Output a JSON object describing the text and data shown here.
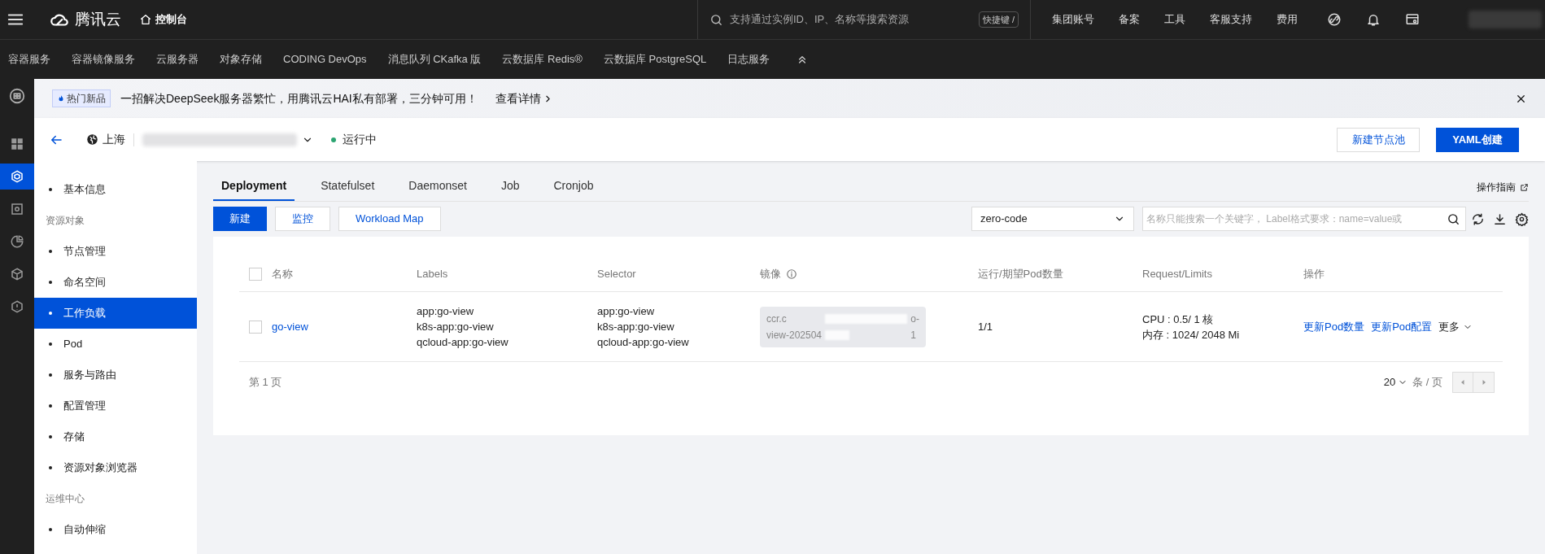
{
  "topbar": {
    "logo": "腾讯云",
    "console": "控制台",
    "search_placeholder": "支持通过实例ID、IP、名称等搜索资源",
    "shortcut": "快捷键 /",
    "links": [
      "集团账号",
      "备案",
      "工具",
      "客服支持",
      "费用"
    ]
  },
  "product_nav": {
    "items": [
      "容器服务",
      "容器镜像服务",
      "云服务器",
      "对象存储",
      "CODING DevOps",
      "消息队列 CKafka 版",
      "云数据库 Redis®",
      "云数据库 PostgreSQL",
      "日志服务"
    ]
  },
  "rail": {
    "items": [
      {
        "kind": "grid",
        "selected": false
      },
      {
        "kind": "hex",
        "selected": true
      },
      {
        "kind": "square",
        "selected": false
      },
      {
        "kind": "pie",
        "selected": false
      },
      {
        "kind": "cube",
        "selected": false
      },
      {
        "kind": "alert",
        "selected": false
      }
    ]
  },
  "banner": {
    "tag": "热门新品",
    "text": "一招解决DeepSeek服务器繁忙，用腾讯云HAI私有部署，三分钟可用！",
    "link": "查看详情"
  },
  "header": {
    "region": "上海",
    "status": "运行中",
    "buttons": [
      {
        "label": "新建节点池",
        "kind": "secondary"
      },
      {
        "label": "YAML创建",
        "kind": "primary"
      }
    ]
  },
  "sidebar": {
    "items": [
      {
        "kind": "item",
        "label": "基本信息",
        "selected": false
      },
      {
        "kind": "section",
        "label": "资源对象"
      },
      {
        "kind": "item",
        "label": "节点管理",
        "selected": false
      },
      {
        "kind": "item",
        "label": "命名空间",
        "selected": false
      },
      {
        "kind": "item",
        "label": "工作负载",
        "selected": true
      },
      {
        "kind": "item",
        "label": "Pod",
        "selected": false
      },
      {
        "kind": "item",
        "label": "服务与路由",
        "selected": false
      },
      {
        "kind": "item",
        "label": "配置管理",
        "selected": false
      },
      {
        "kind": "item",
        "label": "存储",
        "selected": false
      },
      {
        "kind": "item",
        "label": "资源对象浏览器",
        "selected": false
      },
      {
        "kind": "section",
        "label": "运维中心"
      },
      {
        "kind": "item",
        "label": "自动伸缩",
        "selected": false
      }
    ]
  },
  "tabs": [
    {
      "label": "Deployment",
      "selected": true
    },
    {
      "label": "Statefulset",
      "selected": false
    },
    {
      "label": "Daemonset",
      "selected": false
    },
    {
      "label": "Job",
      "selected": false
    },
    {
      "label": "Cronjob",
      "selected": false
    }
  ],
  "guide_link": "操作指南",
  "toolbar": {
    "buttons": [
      {
        "label": "新建",
        "kind": "primary"
      },
      {
        "label": "监控",
        "kind": "link"
      },
      {
        "label": "Workload Map",
        "kind": "link"
      }
    ],
    "namespace": "zero-code",
    "search_placeholder": "名称只能搜索一个关键字， Label格式要求：name=value或"
  },
  "table": {
    "select_all_checked": false,
    "columns": [
      "名称",
      "Labels",
      "Selector",
      "镜像",
      "运行/期望Pod数量",
      "Request/Limits",
      "操作"
    ],
    "rows": [
      {
        "checked": false,
        "name": "go-view",
        "labels": [
          "app:go-view",
          "k8s-app:go-view",
          "qcloud-app:go-view"
        ],
        "selector": [
          "app:go-view",
          "k8s-app:go-view",
          "qcloud-app:go-view"
        ],
        "image": [
          "ccr.c",
          "o-",
          "view-202504",
          "1"
        ],
        "pods": "1/1",
        "resources": [
          "CPU : 0.5/ 1 核",
          "内存 : 1024/ 2048 Mi"
        ],
        "actions": [
          "更新Pod数量",
          "更新Pod配置"
        ],
        "more": "更多"
      }
    ]
  },
  "pagination": {
    "page": "第 1 页",
    "page_size": "20",
    "unit": "条 / 页"
  }
}
